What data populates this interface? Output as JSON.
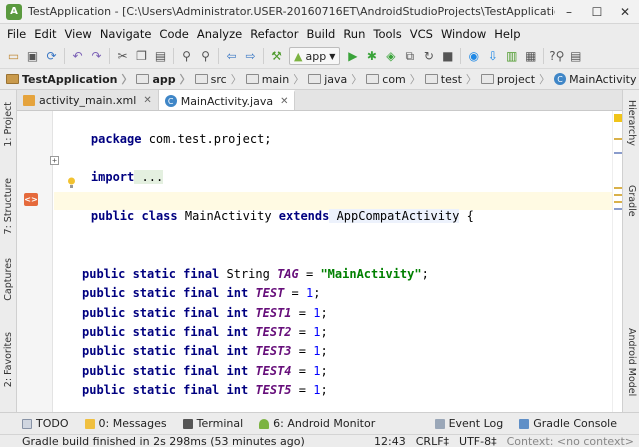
{
  "window": {
    "title": "TestApplication - [C:\\Users\\Administrator.USER-20160716ET\\AndroidStudioProjects\\TestApplication] -...",
    "minimize": "–",
    "maximize": "☐",
    "close": "✕"
  },
  "menu": [
    "File",
    "Edit",
    "View",
    "Navigate",
    "Code",
    "Analyze",
    "Refactor",
    "Build",
    "Run",
    "Tools",
    "VCS",
    "Window",
    "Help"
  ],
  "toolbar": {
    "run_config": "app"
  },
  "breadcrumb": [
    "TestApplication",
    "app",
    "src",
    "main",
    "java",
    "com",
    "test",
    "project",
    "MainActivity"
  ],
  "editor_tabs": [
    {
      "label": "activity_main.xml",
      "active": false
    },
    {
      "label": "MainActivity.java",
      "active": true
    }
  ],
  "code": {
    "package_kw": "package",
    "package_name": " com.test.project;",
    "import_kw": "import",
    "import_fold": " ...",
    "class_decl": {
      "public": "public",
      "class": " class",
      "name": " MainActivity",
      "extends": " extends",
      "super": " AppCompatActivity",
      "brace": " {"
    },
    "fields": [
      {
        "mods": "public static final",
        "type": " String",
        "name": " TAG",
        "eq": " = ",
        "value": "\"MainActivity\"",
        "end": ";"
      },
      {
        "mods": "public static final",
        "type": " int",
        "name": " TEST",
        "eq": " = ",
        "value": "1",
        "end": ";"
      },
      {
        "mods": "public static final",
        "type": " int",
        "name": " TEST1",
        "eq": " = ",
        "value": "1",
        "end": ";"
      },
      {
        "mods": "public static final",
        "type": " int",
        "name": " TEST2",
        "eq": " = ",
        "value": "1",
        "end": ";"
      },
      {
        "mods": "public static final",
        "type": " int",
        "name": " TEST3",
        "eq": " = ",
        "value": "1",
        "end": ";"
      },
      {
        "mods": "public static final",
        "type": " int",
        "name": " TEST4",
        "eq": " = ",
        "value": "1",
        "end": ";"
      },
      {
        "mods": "public static final",
        "type": " int",
        "name": " TEST5",
        "eq": " = ",
        "value": "1",
        "end": ";"
      }
    ]
  },
  "left_tool_tabs": [
    "1: Project",
    "7: Structure",
    "Captures",
    "2: Favorites"
  ],
  "right_tool_tabs": [
    "Hierarchy",
    "Gradle",
    "Android Model"
  ],
  "bottom_tools": [
    "TODO",
    "0: Messages",
    "Terminal",
    "6: Android Monitor",
    "Event Log",
    "Gradle Console"
  ],
  "status": {
    "message": "Gradle build finished in 2s 298ms (53 minutes ago)",
    "position": "12:43",
    "line_sep": "CRLF‡",
    "encoding": "UTF-8‡",
    "context": "Context: <no context>"
  }
}
